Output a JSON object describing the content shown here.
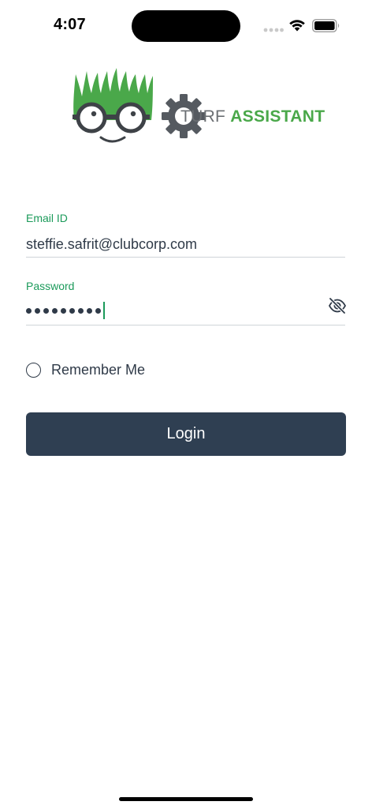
{
  "status_bar": {
    "time": "4:07",
    "icons": [
      "signal-icon",
      "wifi-icon",
      "battery-icon"
    ]
  },
  "logo": {
    "text_part1": "TURF",
    "text_part2": "ASSISTANT",
    "colors": {
      "grass_green": "#4aa84a",
      "gear_gray": "#555a60"
    }
  },
  "form": {
    "email_label": "Email ID",
    "email_value": "steffie.safrit@clubcorp.com",
    "password_label": "Password",
    "password_mask_length": 9,
    "password_toggle_icon": "eye-off-icon",
    "remember_label": "Remember Me",
    "remember_checked": false
  },
  "login_button": {
    "label": "Login",
    "color": "#2f3f52"
  },
  "colors": {
    "accent_green": "#1b9a5a",
    "text_dark": "#2f3a48",
    "divider": "#cfd4d8"
  }
}
